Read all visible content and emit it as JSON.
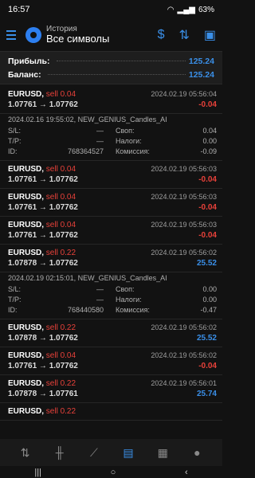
{
  "status": {
    "time": "16:57",
    "battery": "63%"
  },
  "appbar": {
    "subtitle": "История",
    "title": "Все символы"
  },
  "summary": {
    "profit_label": "Прибыль:",
    "profit_value": "125.24",
    "balance_label": "Баланс:",
    "balance_value": "125.24"
  },
  "deals": [
    {
      "symbol": "EURUSD,",
      "side": "sell 0.04",
      "time": "2024.02.19 05:56:04",
      "prices": "1.07761 → 1.07762",
      "profit": "-0.04",
      "positive": false
    },
    {
      "symbol": "EURUSD,",
      "side": "sell 0.04",
      "time": "2024.02.19 05:56:03",
      "prices": "1.07761 → 1.07762",
      "profit": "-0.04",
      "positive": false
    },
    {
      "symbol": "EURUSD,",
      "side": "sell 0.04",
      "time": "2024.02.19 05:56:03",
      "prices": "1.07761 → 1.07762",
      "profit": "-0.04",
      "positive": false
    },
    {
      "symbol": "EURUSD,",
      "side": "sell 0.04",
      "time": "2024.02.19 05:56:03",
      "prices": "1.07761 → 1.07762",
      "profit": "-0.04",
      "positive": false
    },
    {
      "symbol": "EURUSD,",
      "side": "sell 0.22",
      "time": "2024.02.19 05:56:02",
      "prices": "1.07878 → 1.07762",
      "profit": "25.52",
      "positive": true
    },
    {
      "symbol": "EURUSD,",
      "side": "sell 0.22",
      "time": "2024.02.19 05:56:02",
      "prices": "1.07878 → 1.07762",
      "profit": "25.52",
      "positive": true
    },
    {
      "symbol": "EURUSD,",
      "side": "sell 0.04",
      "time": "2024.02.19 05:56:02",
      "prices": "1.07761 → 1.07762",
      "profit": "-0.04",
      "positive": false
    },
    {
      "symbol": "EURUSD,",
      "side": "sell 0.22",
      "time": "2024.02.19 05:56:01",
      "prices": "1.07878 → 1.07761",
      "profit": "25.74",
      "positive": true
    },
    {
      "symbol": "EURUSD,",
      "side": "sell 0.22",
      "time": "",
      "prices": "",
      "profit": "",
      "positive": true
    }
  ],
  "details": [
    {
      "comment": "2024.02.16 19:55:02, NEW_GENIUS_Candles_AI",
      "sl_label": "S/L:",
      "sl": "—",
      "swap_label": "Своп:",
      "swap": "0.04",
      "tp_label": "T/P:",
      "tp": "—",
      "tax_label": "Налоги:",
      "tax": "0.00",
      "id_label": "ID:",
      "id": "768364527",
      "commission_label": "Комиссия:",
      "commission": "-0.09"
    },
    {
      "comment": "2024.02.19 02:15:01, NEW_GENIUS_Candles_AI",
      "sl_label": "S/L:",
      "sl": "—",
      "swap_label": "Своп:",
      "swap": "0.00",
      "tp_label": "T/P:",
      "tp": "—",
      "tax_label": "Налоги:",
      "tax": "0.00",
      "id_label": "ID:",
      "id": "768440580",
      "commission_label": "Комиссия:",
      "commission": "-0.47"
    }
  ],
  "tabs": [
    "quotes-icon",
    "chart-icon",
    "trade-icon",
    "history-icon",
    "news-icon",
    "messages-icon"
  ],
  "colors": {
    "accent": "#3a8fe8",
    "loss": "#e8413a",
    "background": "#121212"
  }
}
